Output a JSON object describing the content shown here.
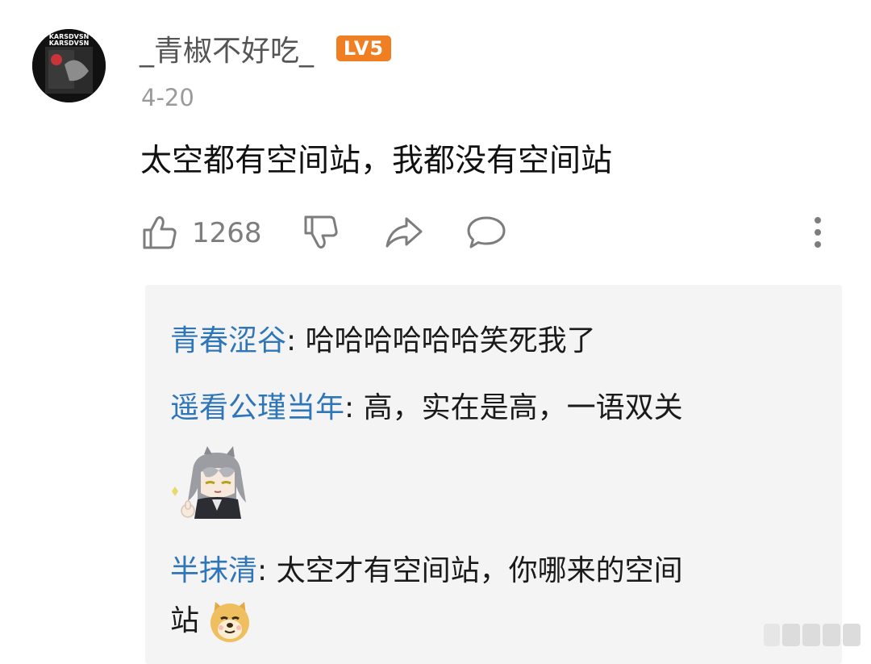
{
  "post": {
    "username": "_青椒不好吃_",
    "level_badge": "LV5",
    "date": "4-20",
    "content": "太空都有空间站，我都没有空间站",
    "like_count": "1268"
  },
  "avatar": {
    "text_line1": "KARSDVSN",
    "text_line2": "KARSDVSN"
  },
  "replies": [
    {
      "name": "青春涩谷",
      "sep": ": ",
      "text": "哈哈哈哈哈哈笑死我了"
    },
    {
      "name": "遥看公瑾当年",
      "sep": ": ",
      "text": "高，实在是高，一语双关"
    },
    {
      "name": "半抹清",
      "sep": ": ",
      "text": "太空才有空间站，你哪来的空间",
      "text_cont": "站"
    }
  ],
  "colors": {
    "accent_name": "#2f76b8",
    "badge": "#f07e22",
    "meta_grey": "#9a9a9a"
  },
  "icons": [
    "like-icon",
    "dislike-icon",
    "share-icon",
    "comment-icon",
    "more-icon",
    "doge-emoji-icon"
  ]
}
